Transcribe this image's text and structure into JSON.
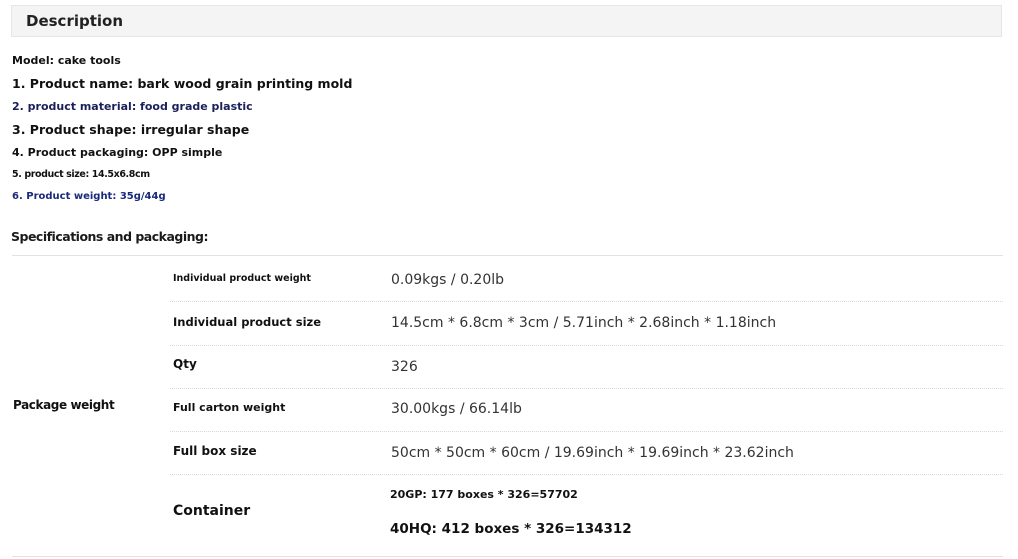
{
  "description": {
    "title": "Description",
    "lines": [
      "Model: cake tools",
      "1. Product name: bark wood grain printing mold",
      "2. product material: food grade plastic",
      "3. Product shape: irregular shape",
      "4. Product packaging: OPP simple",
      "5. product size: 14.5x6.8cm",
      "6. Product weight: 35g/44g"
    ]
  },
  "specifications": {
    "title": "Specifications and packaging:",
    "group_label": "Package weight",
    "rows": [
      {
        "label": "Individual product weight",
        "value": "0.09kgs / 0.20lb"
      },
      {
        "label": "Individual product size",
        "value": "14.5cm * 6.8cm * 3cm / 5.71inch * 2.68inch * 1.18inch"
      },
      {
        "label": "Qty",
        "value": "326"
      },
      {
        "label": "Full carton weight",
        "value": "30.00kgs / 66.14lb"
      },
      {
        "label": "Full box size",
        "value": "50cm * 50cm * 60cm / 19.69inch * 19.69inch * 23.62inch"
      }
    ],
    "container": {
      "label": "Container",
      "values": [
        "20GP: 177 boxes * 326=57702",
        "40HQ: 412 boxes * 326=134312"
      ]
    }
  },
  "colors": {
    "navy_text": "#1a1f5a",
    "blue_text": "#1a2a7a",
    "header_bg": "#f4f4f4"
  }
}
